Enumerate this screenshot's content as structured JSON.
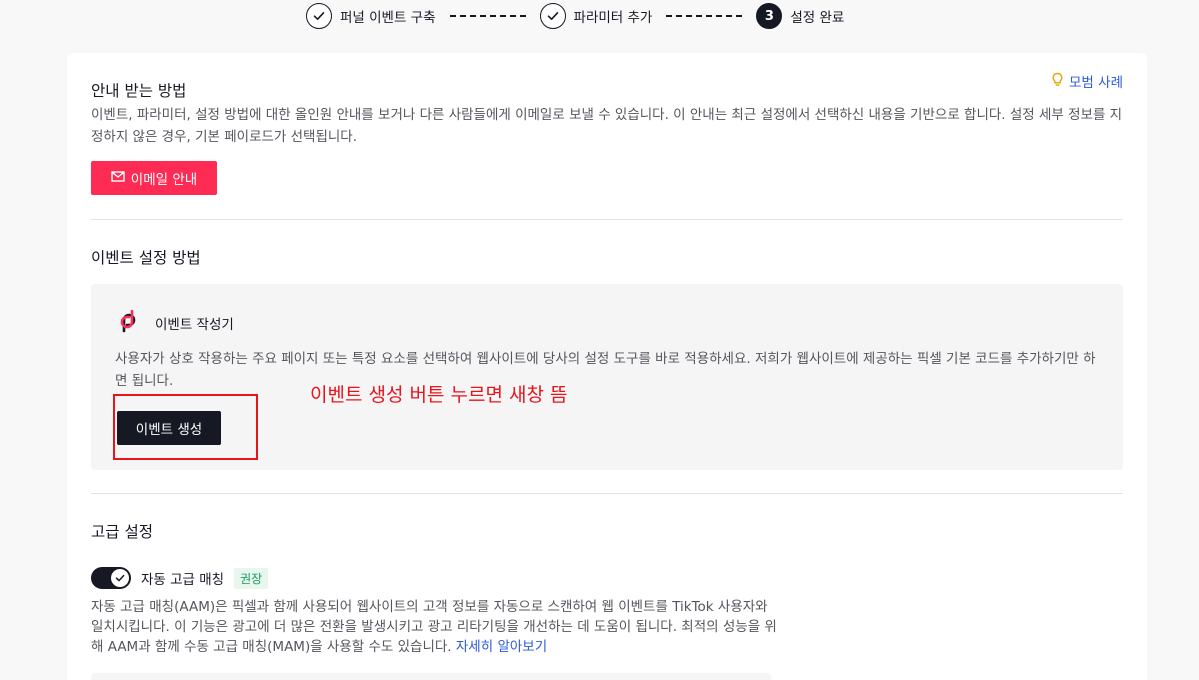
{
  "stepper": {
    "steps": [
      {
        "label": "퍼널 이벤트 구축",
        "state": "done"
      },
      {
        "label": "파라미터 추가",
        "state": "done"
      },
      {
        "label": "설정 완료",
        "state": "active",
        "number": "3"
      }
    ]
  },
  "guide": {
    "title": "안내 받는 방법",
    "model_link": "모범 사례",
    "description": "이벤트, 파라미터, 설정 방법에 대한 올인원 안내를 보거나 다른 사람들에게 이메일로 보낼 수 있습니다. 이 안내는 최근 설정에서 선택하신 내용을 기반으로 합니다. 설정 세부 정보를 지정하지 않은 경우, 기본 페이로드가 선택됩니다.",
    "email_button": "이메일 안내"
  },
  "event_setup": {
    "title": "이벤트 설정 방법",
    "builder_title": "이벤트 작성기",
    "builder_description": "사용자가 상호 작용하는 주요 페이지 또는 특정 요소를 선택하여 웹사이트에 당사의 설정 도구를 바로 적용하세요. 저희가 웹사이트에 제공하는 픽셀 기본 코드를 추가하기만 하면 됩니다.",
    "create_button": "이벤트 생성"
  },
  "annotation": {
    "note": "이벤트 생성 버튼 누르면 새창 뜸",
    "color": "#e8141c"
  },
  "advanced": {
    "title": "고급 설정",
    "aam_label": "자동 고급 매칭",
    "aam_badge": "권장",
    "aam_enabled": true,
    "aam_description": "자동 고급 매칭(AAM)은 픽셀과 함께 사용되어 웹사이트의 고객 정보를 자동으로 스캔하여 웹 이벤트를 TikTok 사용자와 일치시킵니다. 이 기능은 광고에 더 많은 전환을 발생시키고 광고 리타기팅을 개선하는 데 도움이 됩니다. 최적의 성능을 위해 AAM과 함께 수동 고급 매칭(MAM)을 사용할 수도 있습니다.",
    "learn_more": "자세히 알아보기"
  },
  "colors": {
    "primary": "#fe2c55",
    "link": "#2e5bd8",
    "dark": "#161823"
  }
}
